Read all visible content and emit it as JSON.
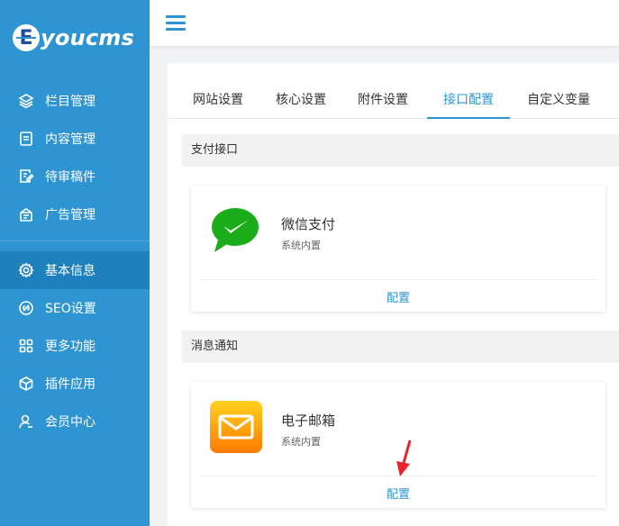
{
  "logo": {
    "badge": "E",
    "text": "youcms"
  },
  "sidebar": {
    "items": [
      {
        "label": "栏目管理",
        "icon": "layers-icon"
      },
      {
        "label": "内容管理",
        "icon": "document-icon"
      },
      {
        "label": "待审稿件",
        "icon": "edit-document-icon"
      },
      {
        "label": "广告管理",
        "icon": "ad-icon"
      },
      {
        "label": "基本信息",
        "icon": "gear-icon"
      },
      {
        "label": "SEO设置",
        "icon": "seo-icon"
      },
      {
        "label": "更多功能",
        "icon": "grid-icon"
      },
      {
        "label": "插件应用",
        "icon": "plugin-cube-icon"
      },
      {
        "label": "会员中心",
        "icon": "user-icon"
      }
    ],
    "active_index": 4
  },
  "tabs": [
    {
      "label": "网站设置"
    },
    {
      "label": "核心设置"
    },
    {
      "label": "附件设置"
    },
    {
      "label": "接口配置"
    },
    {
      "label": "自定义变量"
    }
  ],
  "active_tab": 3,
  "sections": {
    "payment": {
      "title": "支付接口",
      "card": {
        "title": "微信支付",
        "subtitle": "系统内置",
        "action": "配置",
        "icon": "wechat-pay-icon"
      }
    },
    "notification": {
      "title": "消息通知",
      "card": {
        "title": "电子邮箱",
        "subtitle": "系统内置",
        "action": "配置",
        "icon": "email-icon"
      }
    }
  },
  "colors": {
    "sidebar": "#2f94d2",
    "sidebar_active": "#1e80bd",
    "accent": "#2f94d2",
    "annotation_arrow": "#e8252a"
  }
}
